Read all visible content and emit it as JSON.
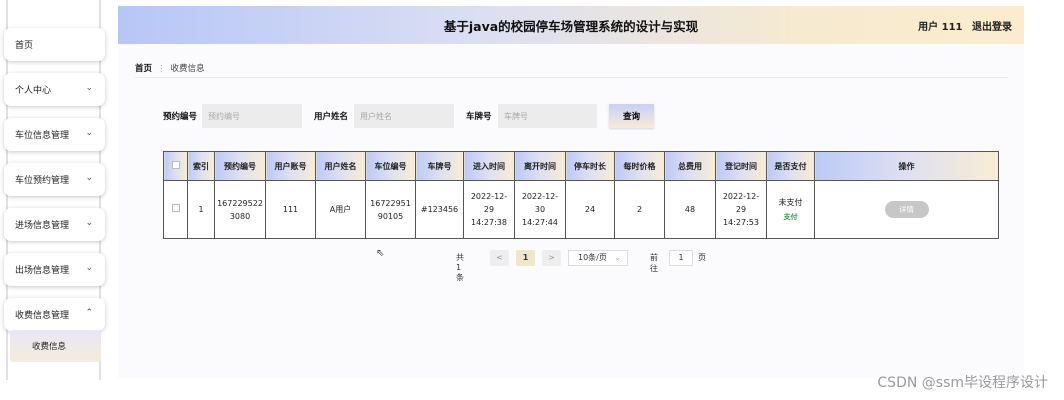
{
  "header": {
    "title": "基于java的校园停车场管理系统的设计与实现",
    "user": "用户 111",
    "logout": "退出登录"
  },
  "sidebar": {
    "items": [
      {
        "label": "首页",
        "chevron": ""
      },
      {
        "label": "个人中心",
        "chevron": "⌄"
      },
      {
        "label": "车位信息管理",
        "chevron": "⌄"
      },
      {
        "label": "车位预约管理",
        "chevron": "⌄"
      },
      {
        "label": "进场信息管理",
        "chevron": "⌄"
      },
      {
        "label": "出场信息管理",
        "chevron": "⌄"
      },
      {
        "label": "收费信息管理",
        "chevron": "⌃"
      }
    ],
    "active_sub": "收费信息"
  },
  "breadcrumb": {
    "home": "首页",
    "sep": "⋮",
    "current": "收费信息"
  },
  "search": {
    "booking_label": "预约编号",
    "booking_placeholder": "预约编号",
    "name_label": "用户姓名",
    "name_placeholder": "用户姓名",
    "plate_label": "车牌号",
    "plate_placeholder": "车牌号",
    "button": "查询"
  },
  "table": {
    "headers": [
      "索引",
      "预约编号",
      "用户账号",
      "用户姓名",
      "车位编号",
      "车牌号",
      "进入时间",
      "离开时间",
      "停车时长",
      "每时价格",
      "总费用",
      "登记时间",
      "是否支付",
      "操作"
    ],
    "rows": [
      {
        "index": "1",
        "booking": "1672295223080",
        "account": "111",
        "name": "A用户",
        "spot": "1672295190105",
        "plate": "#123456",
        "enter": "2022-12-29 14:27:38",
        "leave": "2022-12-30 14:27:44",
        "duration": "24",
        "price": "2",
        "total": "48",
        "register": "2022-12-29 14:27:53",
        "paid": "未支付",
        "pay_link": "支付",
        "detail": "详情"
      }
    ]
  },
  "pager": {
    "total": "共 1 条",
    "prev": "<",
    "current": "1",
    "next": ">",
    "size": "10条/页",
    "size_chevron": "⌄",
    "goto": "前往",
    "goto_value": "1",
    "page_unit": "页"
  },
  "watermark": "CSDN @ssm毕设程序设计",
  "colors": {
    "header_left": "#b6c6f7",
    "header_right": "#fbeccd",
    "pay_link": "#2a9b4a"
  }
}
